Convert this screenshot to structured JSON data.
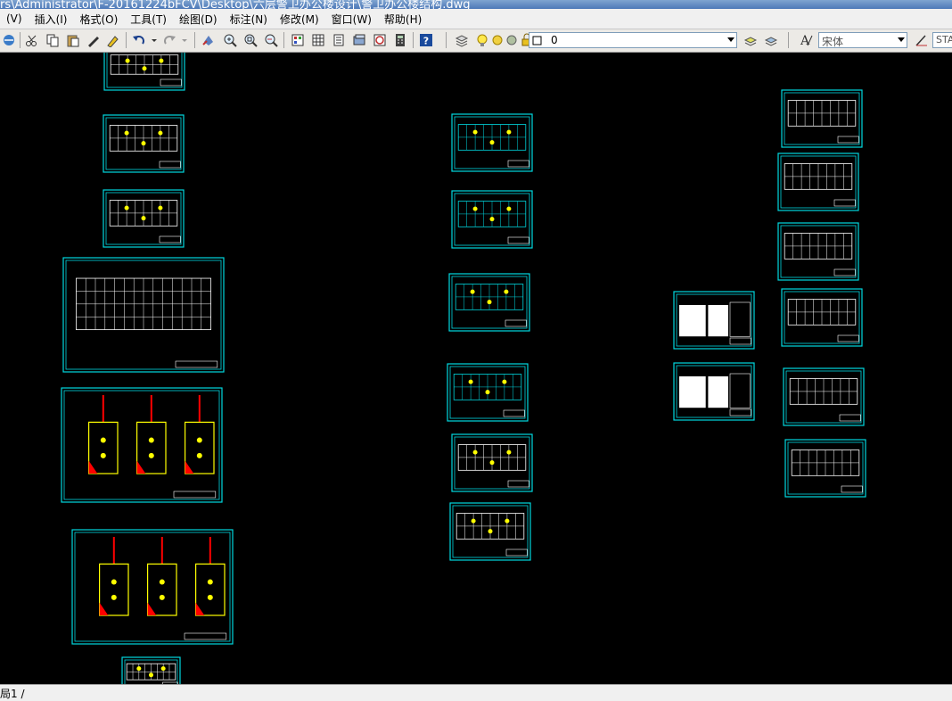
{
  "window": {
    "title": "rs\\Administrator\\F-20161224bFCV\\Desktop\\六层警卫办公楼设计\\警卫办公楼结构.dwg"
  },
  "menu": {
    "items": [
      "(V)",
      "插入(I)",
      "格式(O)",
      "工具(T)",
      "绘图(D)",
      "标注(N)",
      "修改(M)",
      "窗口(W)",
      "帮助(H)"
    ]
  },
  "toolbar": {
    "layer_value": "0",
    "font_value": "宋体",
    "style_value": "STA"
  },
  "colors": {
    "canvas": "#000000",
    "sheet_border": "#00d8e0",
    "drawing_yellow": "#ffff00",
    "drawing_red": "#ff0000",
    "drawing_white": "#ffffff"
  },
  "status": {
    "layout_tab": "局1 /"
  }
}
